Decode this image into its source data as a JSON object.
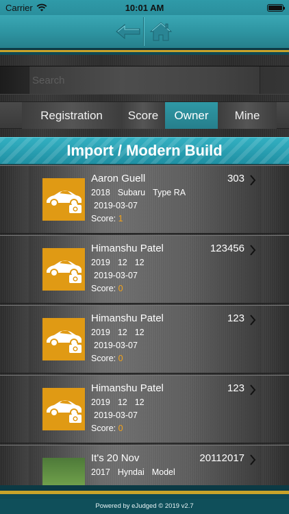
{
  "status_bar": {
    "carrier": "Carrier",
    "time": "10:01 AM",
    "wifi_icon": "wifi-icon",
    "battery_icon": "battery-icon"
  },
  "header": {
    "back_icon": "back-arrow-icon",
    "home_icon": "home-icon",
    "accent_color": "#2e95a2"
  },
  "search": {
    "placeholder": "Search",
    "value": ""
  },
  "tabs": [
    {
      "label": "Registration",
      "active": false
    },
    {
      "label": "Score",
      "active": false
    },
    {
      "label": "Owner",
      "active": true
    },
    {
      "label": "Mine",
      "active": false
    }
  ],
  "category": {
    "title": "Import / Modern Build"
  },
  "entries": [
    {
      "name": "Aaron Guell",
      "number": "303",
      "year": "2018",
      "make": "Subaru",
      "model": "Type RA",
      "date": "2019-03-07",
      "score_label": "Score:",
      "score": "1",
      "thumb": "car-camera-icon"
    },
    {
      "name": "Himanshu Patel",
      "number": "123456",
      "year": "2019",
      "make": "12",
      "model": "12",
      "date": "2019-03-07",
      "score_label": "Score:",
      "score": "0",
      "thumb": "car-camera-icon"
    },
    {
      "name": "Himanshu Patel",
      "number": "123",
      "year": "2019",
      "make": "12",
      "model": "12",
      "date": "2019-03-07",
      "score_label": "Score:",
      "score": "0",
      "thumb": "car-camera-icon"
    },
    {
      "name": "Himanshu Patel",
      "number": "123",
      "year": "2019",
      "make": "12",
      "model": "12",
      "date": "2019-03-07",
      "score_label": "Score:",
      "score": "0",
      "thumb": "car-camera-icon"
    },
    {
      "name": "It's 20 Nov",
      "number": "20112017",
      "year": "2017",
      "make": "Hyndai",
      "model": "Model",
      "date": "",
      "score_label": "",
      "score": "",
      "thumb": "photo"
    }
  ],
  "footer": {
    "text": "Powered by eJudged © 2019 v2.7"
  },
  "colors": {
    "brand_teal": "#2e95a2",
    "score_orange": "#f2a31b",
    "thumb_orange": "#e09a14",
    "gold_stripe": "#c9a32a"
  }
}
